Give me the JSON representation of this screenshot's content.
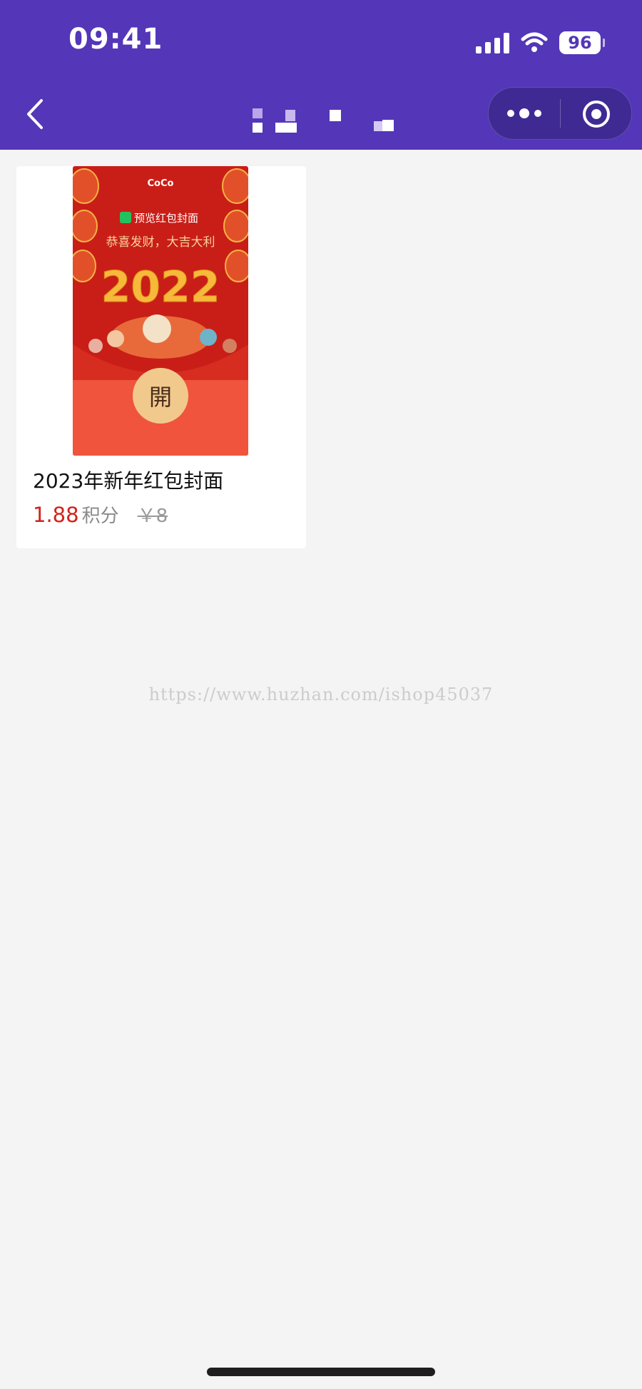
{
  "colors": {
    "brand": "#5436b8",
    "price": "#d0231c"
  },
  "status_bar": {
    "time": "09:41",
    "battery": "96",
    "icons": [
      "cellular-signal-icon",
      "wifi-icon",
      "battery-icon"
    ]
  },
  "nav": {
    "icons": [
      "back-arrow-icon",
      "more-dots-icon",
      "target-circle-icon"
    ]
  },
  "product": {
    "cover_text": {
      "brand": "CoCo",
      "preview": "预览红包封面",
      "greeting": "恭喜发财，大吉大利",
      "year": "2022",
      "open": "開"
    },
    "name": "2023年新年红包封面",
    "price": "1.88",
    "price_unit": "积分",
    "original_price": "￥8"
  },
  "watermark": "https://www.huzhan.com/ishop45037"
}
